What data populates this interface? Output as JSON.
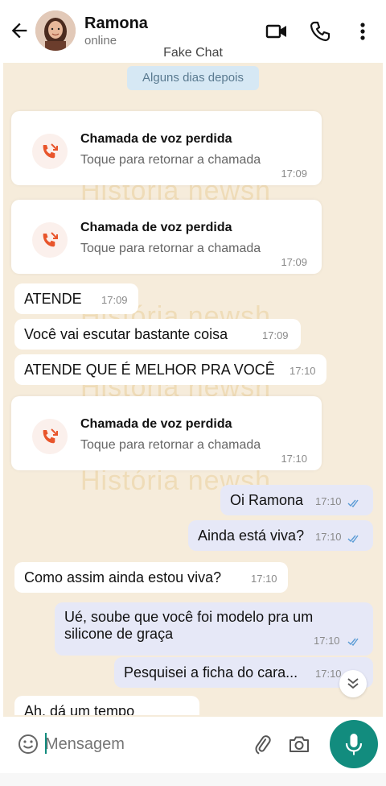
{
  "header": {
    "contact_name": "Ramona",
    "status": "online",
    "watermark_title": "Fake Chat"
  },
  "day_label": "Alguns dias depois",
  "watermark": "História newsh",
  "missed_calls": [
    {
      "title": "Chamada de voz perdida",
      "subtitle": "Toque para retornar a chamada",
      "time": "17:09"
    },
    {
      "title": "Chamada de voz perdida",
      "subtitle": "Toque para retornar a chamada",
      "time": "17:09"
    },
    {
      "title": "Chamada de voz perdida",
      "subtitle": "Toque para retornar a chamada",
      "time": "17:10"
    }
  ],
  "messages": [
    {
      "text": "ATENDE",
      "time": "17:09",
      "direction": "in"
    },
    {
      "text": "Você vai escutar bastante coisa",
      "time": "17:09",
      "direction": "in"
    },
    {
      "text": "ATENDE QUE É MELHOR PRA VOCÊ",
      "time": "17:10",
      "direction": "in"
    },
    {
      "text": "Oi Ramona",
      "time": "17:10",
      "direction": "out",
      "status": "read"
    },
    {
      "text": "Ainda está viva?",
      "time": "17:10",
      "direction": "out",
      "status": "read"
    },
    {
      "text": "Como assim ainda estou viva?",
      "time": "17:10",
      "direction": "in"
    },
    {
      "text_line1": "Ué, soube que você foi modelo pra um",
      "text_line2": "silicone de graça",
      "time": "17:10",
      "direction": "out",
      "status": "read"
    },
    {
      "text": "Pesquisei a ficha do cara...",
      "time": "17:10",
      "direction": "out",
      "status": "read"
    },
    {
      "text": "Ah, dá um tempo",
      "direction": "in"
    }
  ],
  "composer": {
    "placeholder": "Mensagem"
  },
  "icons": {
    "back": "arrow-left-icon",
    "video": "video-call-icon",
    "phone": "voice-call-icon",
    "menu": "more-vert-icon",
    "missed": "missed-call-icon",
    "emoji": "emoji-icon",
    "attach": "paperclip-icon",
    "camera": "camera-icon",
    "mic": "microphone-icon",
    "scroll": "double-chevron-down-icon",
    "read": "double-check-icon"
  },
  "colors": {
    "chat_background": "#f6ecdb",
    "incoming_bubble": "#ffffff",
    "outgoing_bubble": "#e6e8f7",
    "accent": "#128c7e",
    "missed_call": "#e8552b",
    "read_ticks": "#5a9bd5"
  }
}
